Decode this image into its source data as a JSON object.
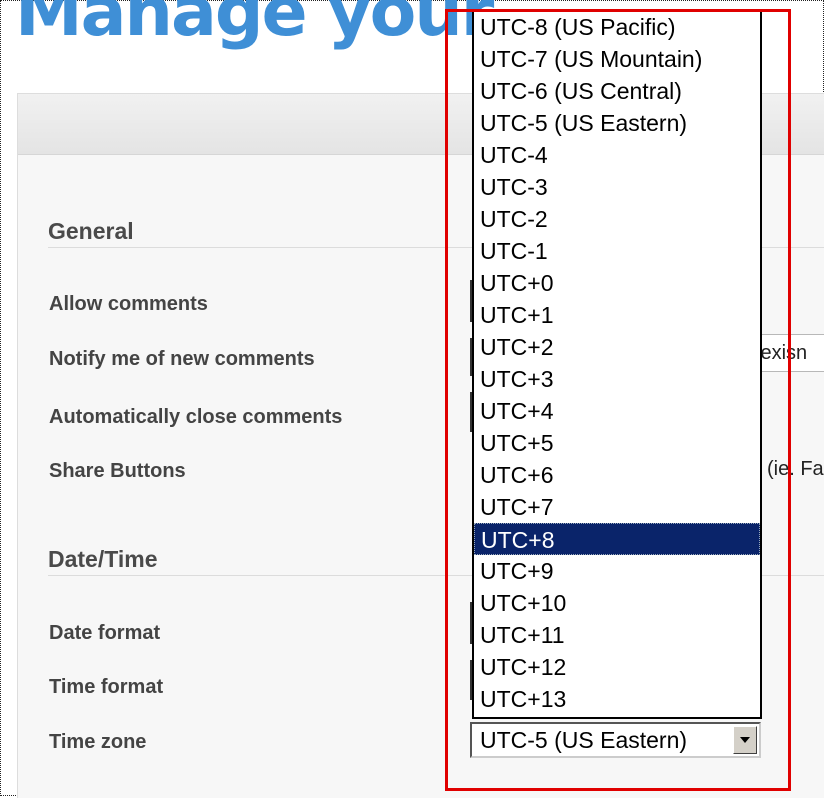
{
  "page": {
    "title": "Manage your"
  },
  "sections": {
    "general": {
      "heading": "General",
      "labels": {
        "allow_comments": "Allow comments",
        "notify_comments": "Notify me of new comments",
        "auto_close": "Automatically close comments",
        "share_buttons": "Share Buttons"
      }
    },
    "datetime": {
      "heading": "Date/Time",
      "labels": {
        "date_format": "Date format",
        "time_format": "Time format",
        "time_zone": "Time zone"
      }
    }
  },
  "partial": {
    "notify_value": "lexisn",
    "share_hint": "(ie. Fa"
  },
  "timezone_select": {
    "selected_value": "UTC-5 (US Eastern)",
    "highlighted_option": "UTC+8",
    "options": [
      "UTC-8 (US Pacific)",
      "UTC-7 (US Mountain)",
      "UTC-6 (US Central)",
      "UTC-5 (US Eastern)",
      "UTC-4",
      "UTC-3",
      "UTC-2",
      "UTC-1",
      "UTC+0",
      "UTC+1",
      "UTC+2",
      "UTC+3",
      "UTC+4",
      "UTC+5",
      "UTC+6",
      "UTC+7",
      "UTC+8",
      "UTC+9",
      "UTC+10",
      "UTC+11",
      "UTC+12",
      "UTC+13"
    ]
  },
  "colors": {
    "title": "#3f8fd6",
    "highlight": "#0a246a",
    "annotation": "#e00000"
  }
}
